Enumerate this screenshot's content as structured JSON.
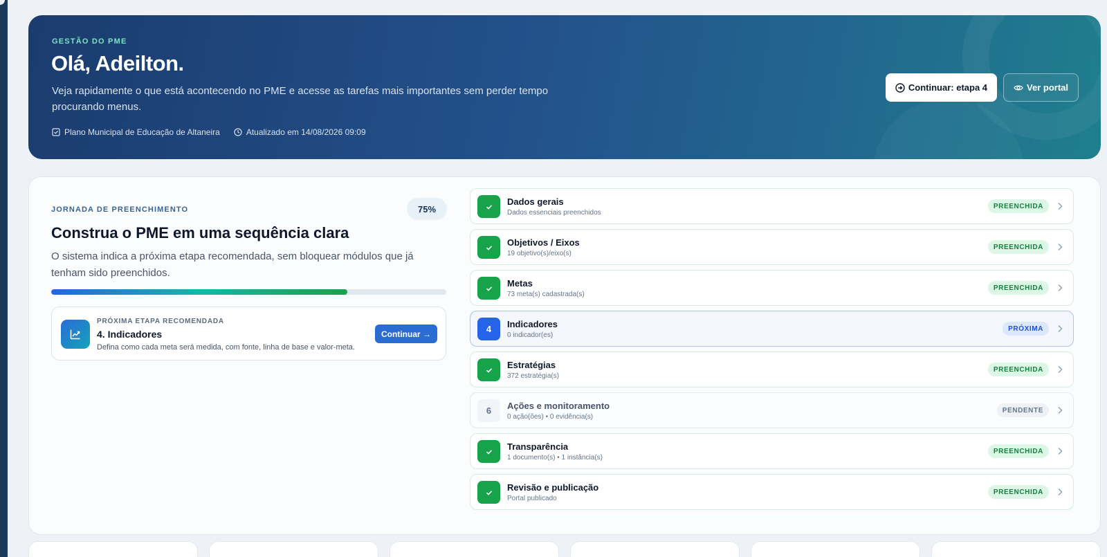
{
  "hero": {
    "kicker": "GESTÃO DO PME",
    "title": "Olá, Adeilton.",
    "description": "Veja rapidamente o que está acontecendo no PME e acesse as tarefas mais importantes sem perder tempo procurando menus.",
    "plan_name": "Plano Municipal de Educação de Altaneira",
    "updated": "Atualizado em 14/08/2026 09:09",
    "continue_label": "Continuar: etapa 4",
    "portal_label": "Ver portal"
  },
  "journey": {
    "kicker": "JORNADA DE PREENCHIMENTO",
    "percent_label": "75%",
    "progress": 0.75,
    "title": "Construa o PME em uma sequência clara",
    "description": "O sistema indica a próxima etapa recomendada, sem bloquear módulos que já tenham sido preenchidos.",
    "next": {
      "kicker": "PRÓXIMA ETAPA RECOMENDADA",
      "title": "4. Indicadores",
      "description": "Defina como cada meta será medida, com fonte, linha de base e valor-meta.",
      "button": "Continuar →"
    },
    "steps": [
      {
        "badge": "",
        "title": "Dados gerais",
        "sub": "Dados essenciais preenchidos",
        "status": "PREENCHIDA",
        "state": "done"
      },
      {
        "badge": "",
        "title": "Objetivos / Eixos",
        "sub": "19 objetivo(s)/eixo(s)",
        "status": "PREENCHIDA",
        "state": "done"
      },
      {
        "badge": "",
        "title": "Metas",
        "sub": "73 meta(s) cadastrada(s)",
        "status": "PREENCHIDA",
        "state": "done"
      },
      {
        "badge": "4",
        "title": "Indicadores",
        "sub": "0 indicador(es)",
        "status": "PRÓXIMA",
        "state": "active"
      },
      {
        "badge": "",
        "title": "Estratégias",
        "sub": "372 estratégia(s)",
        "status": "PREENCHIDA",
        "state": "done"
      },
      {
        "badge": "6",
        "title": "Ações e monitoramento",
        "sub": "0 ação(ões) • 0 evidência(s)",
        "status": "PENDENTE",
        "state": "pending"
      },
      {
        "badge": "",
        "title": "Transparência",
        "sub": "1 documento(s) • 1 instância(s)",
        "status": "PREENCHIDA",
        "state": "done"
      },
      {
        "badge": "",
        "title": "Revisão e publicação",
        "sub": "Portal publicado",
        "status": "PREENCHIDA",
        "state": "done"
      }
    ]
  }
}
